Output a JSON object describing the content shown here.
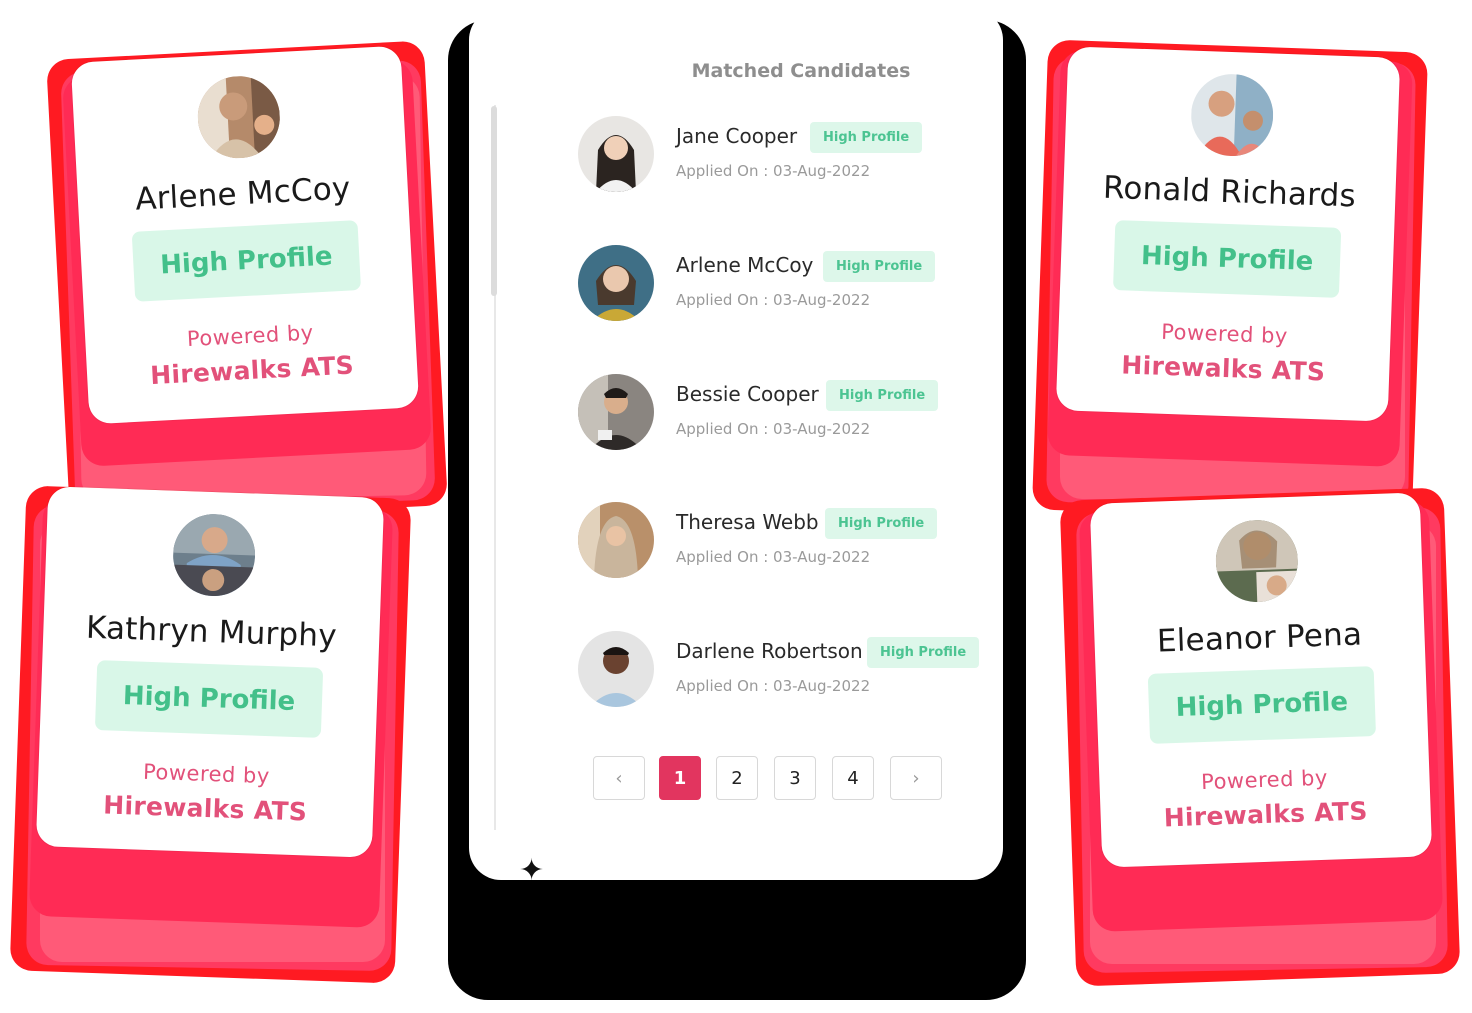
{
  "panel": {
    "title": "Matched Candidates",
    "candidates": [
      {
        "name": "Jane Cooper",
        "badge": "High Profile",
        "date": "Applied On : 03-Aug-2022"
      },
      {
        "name": "Arlene McCoy",
        "badge": "High Profile",
        "date": "Applied On : 03-Aug-2022"
      },
      {
        "name": "Bessie Cooper",
        "badge": "High Profile",
        "date": "Applied On : 03-Aug-2022"
      },
      {
        "name": "Theresa Webb",
        "badge": "High Profile",
        "date": "Applied On : 03-Aug-2022"
      },
      {
        "name": "Darlene Robertson",
        "badge": "High Profile",
        "date": "Applied On : 03-Aug-2022"
      }
    ],
    "pagination": {
      "prev": "‹",
      "pages": [
        "1",
        "2",
        "3",
        "4"
      ],
      "active": "1",
      "next": "›"
    }
  },
  "cards": [
    {
      "name": "Arlene McCoy",
      "badge": "High Profile",
      "powered": "Powered by",
      "brand": "Hirewalks ATS"
    },
    {
      "name": "Kathryn Murphy",
      "badge": "High Profile",
      "powered": "Powered by",
      "brand": "Hirewalks ATS"
    },
    {
      "name": "Ronald Richards",
      "badge": "High Profile",
      "powered": "Powered by",
      "brand": "Hirewalks ATS"
    },
    {
      "name": "Eleanor Pena",
      "badge": "High Profile",
      "powered": "Powered by",
      "brand": "Hirewalks ATS"
    }
  ],
  "colors": {
    "accent": "#e2355f",
    "badge_bg": "#d9f7e8",
    "badge_text": "#43c08a",
    "brand_text": "#e2517a",
    "stack_red": "#ff1a2e",
    "stack_pink": "#ff2f6e"
  }
}
